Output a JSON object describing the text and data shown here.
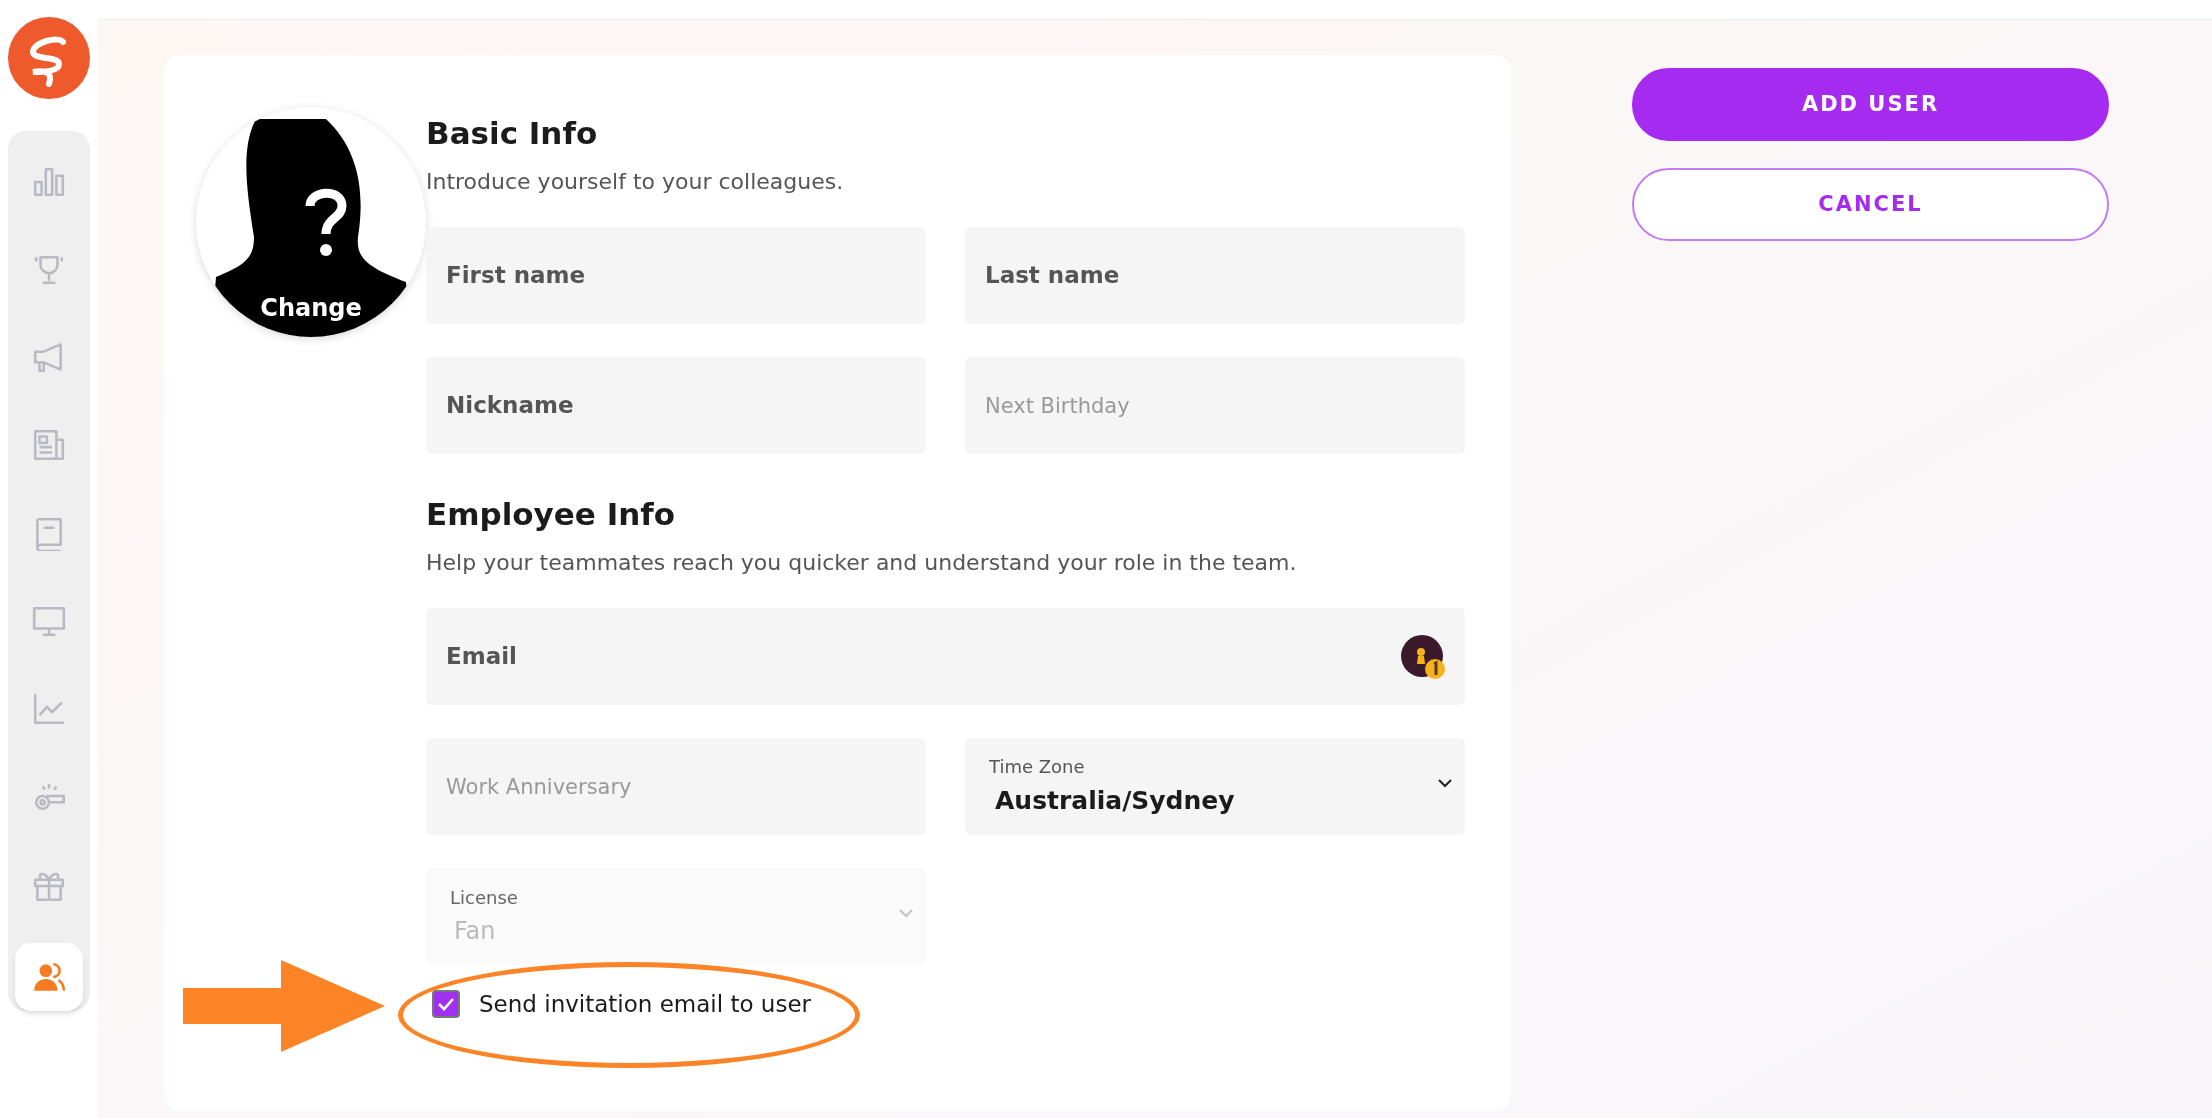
{
  "sidebar": {
    "items": [
      {
        "kind": "bar-chart",
        "selected": false
      },
      {
        "kind": "trophy",
        "selected": false
      },
      {
        "kind": "megaphone",
        "selected": false
      },
      {
        "kind": "newspaper",
        "selected": false
      },
      {
        "kind": "book",
        "selected": false
      },
      {
        "kind": "monitor",
        "selected": false
      },
      {
        "kind": "line-chart",
        "selected": false
      },
      {
        "kind": "whistle",
        "selected": false
      },
      {
        "kind": "gift",
        "selected": false
      },
      {
        "kind": "users",
        "selected": true
      }
    ]
  },
  "avatar": {
    "action": "Change"
  },
  "sections": [
    {
      "title": "Basic Info",
      "subtitle": "Introduce yourself to your colleagues.",
      "fields": [
        {
          "kind": "text",
          "label": "First name",
          "wide": false
        },
        {
          "kind": "text",
          "label": "Last name",
          "wide": false
        },
        {
          "kind": "text",
          "label": "Nickname",
          "wide": false
        },
        {
          "kind": "date",
          "placeholder": "Next Birthday",
          "wide": false
        }
      ]
    },
    {
      "title": "Employee Info",
      "subtitle": "Help your teammates reach you quicker and understand your role in the team.",
      "fields": [
        {
          "kind": "text",
          "label": "Email",
          "wide": true,
          "badge": true
        },
        {
          "kind": "date",
          "placeholder": "Work Anniversary",
          "wide": false
        },
        {
          "kind": "select",
          "label": "Time Zone",
          "value": "Australia/Sydney",
          "disabled": false,
          "wide": false
        },
        {
          "kind": "select",
          "label": "License",
          "value": "Fan",
          "disabled": true,
          "wide": false
        }
      ]
    }
  ],
  "invite": {
    "label": "Send invitation email to user",
    "checked": true
  },
  "buttons": [
    {
      "kind": "primary",
      "label": "ADD USER"
    },
    {
      "kind": "outline",
      "label": "CANCEL"
    }
  ]
}
